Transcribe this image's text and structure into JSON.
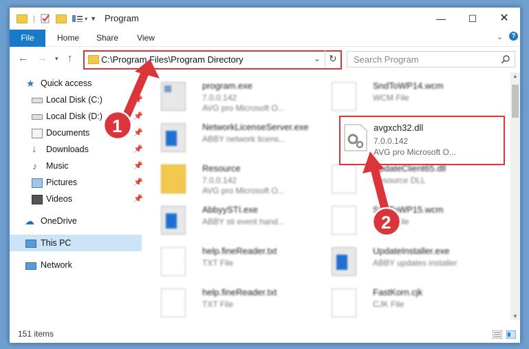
{
  "window": {
    "title": "Program"
  },
  "ribbon": {
    "tabs": [
      "File",
      "Home",
      "Share",
      "View"
    ]
  },
  "address": {
    "path": "C:\\Program Files\\Program Directory"
  },
  "search": {
    "placeholder": "Search Program"
  },
  "sidebar": {
    "items": [
      {
        "label": "Quick access",
        "icon": "star-icon",
        "pinned": false
      },
      {
        "label": "Local Disk (C:)",
        "icon": "drive-icon",
        "pinned": true
      },
      {
        "label": "Local Disk (D:)",
        "icon": "drive-icon",
        "pinned": true
      },
      {
        "label": "Documents",
        "icon": "documents-icon",
        "pinned": true
      },
      {
        "label": "Downloads",
        "icon": "download-arrow-icon",
        "pinned": true
      },
      {
        "label": "Music",
        "icon": "music-note-icon",
        "pinned": true
      },
      {
        "label": "Pictures",
        "icon": "pictures-icon",
        "pinned": true
      },
      {
        "label": "Videos",
        "icon": "film-icon",
        "pinned": true
      },
      {
        "label": "OneDrive",
        "icon": "cloud-icon",
        "pinned": false
      },
      {
        "label": "This PC",
        "icon": "monitor-icon",
        "pinned": false,
        "selected": true
      },
      {
        "label": "Network",
        "icon": "network-icon",
        "pinned": false
      }
    ]
  },
  "files": [
    {
      "name": "program.exe",
      "line2": "7.0.0.142",
      "line3": "AVG pro Microsoft O...",
      "icon": "exe-icon"
    },
    {
      "name": "SndToWP14.wcm",
      "line2": "WCM File",
      "line3": "",
      "icon": "document-icon"
    },
    {
      "name": "NetworkLicenseServer.exe",
      "line2": "ABBY network licens...",
      "line3": "",
      "icon": "window-app-icon"
    },
    {
      "name": "avgxch32.dll",
      "line2": "7.0.0.142",
      "line3": "AVG pro Microsoft O...",
      "icon": "dll-gear-icon"
    },
    {
      "name": "Resource",
      "line2": "7.0.0.142",
      "line3": "AVG pro Microsoft O...",
      "icon": "folder-icon"
    },
    {
      "name": "UpdateClient65.dll",
      "line2": "Resource DLL",
      "line3": "",
      "icon": "dll-gear-icon"
    },
    {
      "name": "AbbyySTI.exe",
      "line2": "ABBY sti event hand...",
      "line3": "",
      "icon": "window-app-icon"
    },
    {
      "name": "SndToWP15.wcm",
      "line2": "WCM File",
      "line3": "",
      "icon": "document-icon"
    },
    {
      "name": "help.fineReader.txt",
      "line2": "TXT File",
      "line3": "",
      "icon": "document-icon"
    },
    {
      "name": "UpdateInstaller.exe",
      "line2": "ABBY updates installer",
      "line3": "",
      "icon": "window-app-icon"
    },
    {
      "name": "help.fineReader.txt",
      "line2": "TXT File",
      "line3": "",
      "icon": "document-icon"
    },
    {
      "name": "FastKorn.cjk",
      "line2": "CJK File",
      "line3": "",
      "icon": "document-icon"
    }
  ],
  "status": {
    "count": "151 items"
  },
  "annotations": {
    "step1": "1",
    "step2": "2"
  },
  "colors": {
    "accent": "#1979ca",
    "highlight": "#d9353a",
    "selected": "#cce4f7"
  }
}
